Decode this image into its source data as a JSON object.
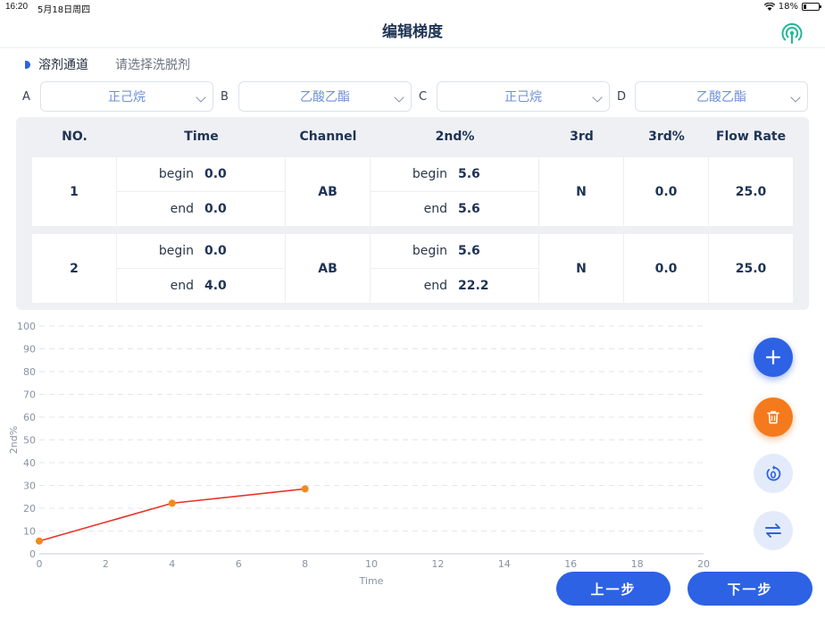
{
  "status": {
    "time": "16:20",
    "date": "5月18日周四",
    "battery": "18%",
    "battery_level": 0.18
  },
  "nav": {
    "title": "编辑梯度",
    "right_icon": "wireless-signal-icon"
  },
  "solvent": {
    "heading": "溶剂通道",
    "hint": "请选择洗脱剂"
  },
  "channels": [
    {
      "letter": "A",
      "value": "正己烷"
    },
    {
      "letter": "B",
      "value": "乙酸乙酯"
    },
    {
      "letter": "C",
      "value": "正己烷"
    },
    {
      "letter": "D",
      "value": "乙酸乙酯"
    }
  ],
  "table": {
    "headers": [
      "NO.",
      "Time",
      "Channel",
      "2nd%",
      "3rd",
      "3rd%",
      "Flow Rate"
    ],
    "begin_label": "begin",
    "end_label": "end",
    "rows": [
      {
        "no": "1",
        "time_begin": "0.0",
        "time_end": "0.0",
        "channel": "AB",
        "p2_begin": "5.6",
        "p2_end": "5.6",
        "third": "N",
        "third_pct": "0.0",
        "flow": "25.0"
      },
      {
        "no": "2",
        "time_begin": "0.0",
        "time_end": "4.0",
        "channel": "AB",
        "p2_begin": "5.6",
        "p2_end": "22.2",
        "third": "N",
        "third_pct": "0.0",
        "flow": "25.0"
      }
    ]
  },
  "chart_data": {
    "type": "line",
    "xlabel": "Time",
    "ylabel": "2nd%",
    "xlim": [
      0,
      20
    ],
    "ylim": [
      0,
      100
    ],
    "xticks": [
      0,
      2,
      4,
      6,
      8,
      10,
      12,
      14,
      16,
      18,
      20
    ],
    "yticks": [
      0,
      10,
      20,
      30,
      40,
      50,
      60,
      70,
      80,
      90,
      100
    ],
    "grid": true,
    "series": [
      {
        "x": [
          0,
          4,
          8
        ],
        "y": [
          5.6,
          22.2,
          28.5
        ],
        "color": "#e8342a",
        "marker_color": "#f28a1a"
      }
    ]
  },
  "fabs": {
    "add": "plus-icon",
    "delete": "trash-icon",
    "reset": "reset-zero-icon",
    "swap": "swap-arrows-icon"
  },
  "buttons": {
    "prev": "上一步",
    "next": "下一步"
  },
  "colors": {
    "primary": "#2d62e5",
    "danger": "#f57a1d",
    "text": "#1f3354"
  }
}
